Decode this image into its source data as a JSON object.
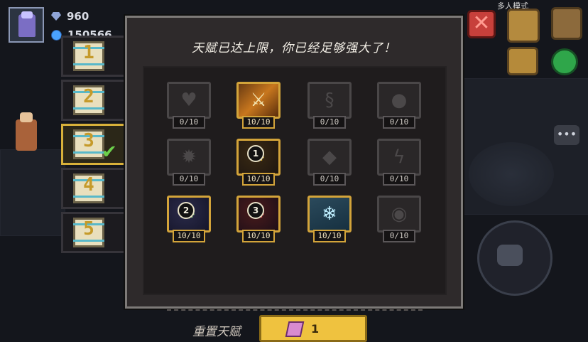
{
  "hud": {
    "gems": "960",
    "coins": "150566",
    "multiplayer_label": "多人模式",
    "close_symbol": "✕",
    "chat_symbol": "•••"
  },
  "tabs": [
    {
      "label": "1",
      "active": false,
      "completed": false
    },
    {
      "label": "2",
      "active": false,
      "completed": false
    },
    {
      "label": "3",
      "active": true,
      "completed": true
    },
    {
      "label": "4",
      "active": false,
      "completed": false
    },
    {
      "label": "5",
      "active": false,
      "completed": false
    }
  ],
  "panel": {
    "title": "天赋已达上限，你已经足够强大了！",
    "talents": [
      [
        {
          "icon": "heart-icon",
          "glyph": "♥",
          "level": "0/10",
          "unlocked": false
        },
        {
          "icon": "sword-icon",
          "glyph": "⚔",
          "level": "10/10",
          "unlocked": true
        },
        {
          "icon": "swirl-icon",
          "glyph": "§",
          "level": "0/10",
          "unlocked": false
        },
        {
          "icon": "drop-icon",
          "glyph": "●",
          "level": "0/10",
          "unlocked": false
        }
      ],
      [
        {
          "icon": "bomb-icon",
          "glyph": "✹",
          "level": "0/10",
          "unlocked": false
        },
        {
          "icon": "gear-1-icon",
          "glyph": "⚙",
          "badge": "1",
          "level": "10/10",
          "unlocked": true
        },
        {
          "icon": "diamond-icon",
          "glyph": "◆",
          "level": "0/10",
          "unlocked": false
        },
        {
          "icon": "lightning-icon",
          "glyph": "ϟ",
          "level": "0/10",
          "unlocked": false
        }
      ],
      [
        {
          "icon": "gear-2-icon",
          "glyph": "⚙",
          "badge": "2",
          "level": "10/10",
          "unlocked": true
        },
        {
          "icon": "gear-3-icon",
          "glyph": "⚙",
          "badge": "3",
          "level": "10/10",
          "unlocked": true
        },
        {
          "icon": "frost-icon",
          "glyph": "❄",
          "level": "10/10",
          "unlocked": true
        },
        {
          "icon": "eye-icon",
          "glyph": "◉",
          "level": "0/10",
          "unlocked": false
        }
      ]
    ],
    "reset": {
      "label": "重置天赋",
      "cost": "1",
      "currency_icon": "crystal-icon"
    }
  },
  "colors": {
    "accent_gold": "#d3a43a",
    "button_yellow": "#efc23f",
    "check_green": "#6cd04b"
  }
}
